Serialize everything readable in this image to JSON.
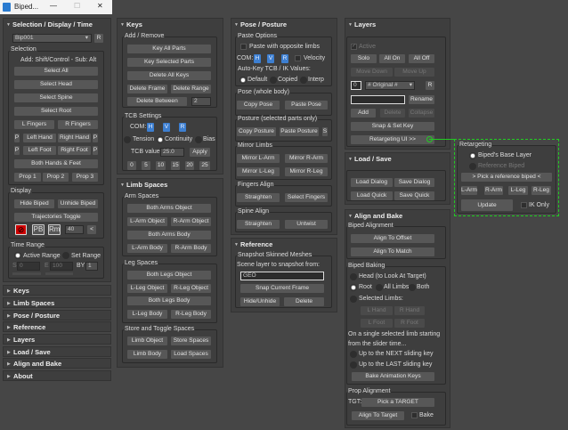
{
  "window": {
    "title": "Biped...",
    "min": "—",
    "max": "☐",
    "close": "✕"
  },
  "c1": {
    "header": "Selection / Display / Time",
    "bip": "Bip001",
    "r": "R",
    "sel": {
      "label": "Selection",
      "hint": "Add: Shift/Control - Sub: Alt",
      "all": "Select All",
      "head": "Select Head",
      "spine": "Select Spine",
      "root": "Select Root",
      "lf": "L Fingers",
      "rf": "R Fingers",
      "p": "P",
      "lh": "Left Hand",
      "rh": "Right Hand",
      "lfo": "Left Foot",
      "rfo": "Right Foot",
      "both": "Both Hands & Feet",
      "p1": "Prop 1",
      "p2": "Prop 2",
      "p3": "Prop 3"
    },
    "disp": {
      "label": "Display",
      "hide": "Hide Biped",
      "unhide": "Unhide Biped",
      "traj": "Trajectories Toggle",
      "pb": "PB",
      "rm": "Rm",
      "val": "40",
      "lt": "<"
    },
    "time": {
      "label": "Time Range",
      "active": "Active Range",
      "set": "Set Range",
      "s": "S",
      "sv": "0",
      "e": "E",
      "ev": "100",
      "by": "BY",
      "byv": "1"
    },
    "rollouts": [
      "Keys",
      "Limb Spaces",
      "Pose / Posture",
      "Reference",
      "Layers",
      "Load / Save",
      "Align and Bake",
      "About"
    ]
  },
  "keys": {
    "header": "Keys",
    "add": "Add / Remove",
    "kall": "Key All Parts",
    "ksel": "Key Selected Parts",
    "dall": "Delete All Keys",
    "dframe": "Delete Frame",
    "drange": "Delete Range",
    "dbetw": "Delete Between",
    "dbv": "2",
    "tcb": "TCB Settings",
    "com": "COM:",
    "h": "H",
    "v": "V",
    "r": "R",
    "tension": "Tension",
    "continuity": "Continuity",
    "bias": "Bias",
    "tcbl": "TCB value:",
    "tcbv": "25.0",
    "apply": "Apply",
    "nums": [
      "0",
      "5",
      "10",
      "15",
      "20",
      "25"
    ]
  },
  "limb": {
    "header": "Limb Spaces",
    "arm": "Arm Spaces",
    "bao": "Both Arms Object",
    "lao": "L-Arm Object",
    "rao": "R-Arm Object",
    "bab": "Both Arms Body",
    "lab": "L-Arm Body",
    "rab": "R-Arm Body",
    "leg": "Leg Spaces",
    "blo": "Both Legs Object",
    "llo": "L-Leg Object",
    "rlo": "R-Leg Object",
    "blb": "Both Legs Body",
    "llb": "L-Leg Body",
    "rlb": "R-Leg Body",
    "store": "Store and Toggle Spaces",
    "lo": "Limb Object",
    "ss": "Store Spaces",
    "lb": "Limb Body",
    "ls": "Load Spaces"
  },
  "pose": {
    "header": "Pose / Posture",
    "paste": "Paste Options",
    "opp": "Paste with opposite limbs",
    "com": "COM:",
    "h": "H",
    "v": "V",
    "r": "R",
    "vel": "Velocity",
    "auto": "Auto-Key TCB / IK Values:",
    "def": "Default",
    "cop": "Copied",
    "interp": "Interp",
    "pwb": "Pose (whole body)",
    "cp": "Copy Pose",
    "pp": "Paste Pose",
    "pos": "Posture (selected parts only)",
    "cpo": "Copy Posture",
    "ppo": "Paste Posture",
    "s": "S",
    "mirror": "Mirror Limbs",
    "mla": "Mirror L-Arm",
    "mra": "Mirror R-Arm",
    "mll": "Mirror L-Leg",
    "mrl": "Mirror R-Leg",
    "fa": "Fingers Align",
    "str": "Straighten",
    "self": "Select Fingers",
    "sa": "Spine Align",
    "untw": "Untwist"
  },
  "ref": {
    "header": "Reference",
    "snap": "Snapshot Skinned Meshes",
    "scene": "Scene layer to snapshot from:",
    "geo": "GEO",
    "scf": "Snap Current Frame",
    "hide": "Hide/Unhide",
    "del": "Delete"
  },
  "layers": {
    "header": "Layers",
    "active": "Active",
    "solo": "Solo",
    "allon": "All On",
    "alloff": "All Off",
    "md": "Move Down",
    "mu": "Move Up",
    "idx": "0",
    "orig": "# Original #",
    "r": "R",
    "rename": "Rename",
    "add": "Add",
    "del": "Delete",
    "coll": "Collapse",
    "snap": "Snap & Set Key",
    "retui": "Retargeting UI  >>"
  },
  "ls": {
    "header": "Load / Save",
    "ld": "Load Dialog",
    "sd": "Save Dialog",
    "lq": "Load Quick",
    "sq": "Save Quick"
  },
  "ab": {
    "header": "Align and Bake",
    "ba": "Biped Alignment",
    "ato": "Align To Offset",
    "atm": "Align To Match",
    "bb": "Biped Baking",
    "head": "Head (to Look At Target)",
    "root": "Root",
    "all": "All Limbs",
    "both": "Both",
    "sl": "Selected Limbs:",
    "lh": "L Hand",
    "rh": "R Hand",
    "lf": "L Foot",
    "rf": "R Foot",
    "t1": "On a single selected limb starting",
    "t2": "from the slider time...",
    "next": "Up to the NEXT sliding key",
    "last": "Up to the LAST sliding key",
    "bake": "Bake Animation Keys",
    "pa": "Prop Alignment",
    "tgt": "TGT:",
    "pick": "Pick a TARGET",
    "att": "Align To Target",
    "bk": "Bake"
  },
  "ret": {
    "title": "Retargeting",
    "base": "Biped's Base Layer",
    "refb": "Reference Biped",
    "pick": ">  Pick a reference biped  <",
    "la": "L-Arm",
    "ra": "R-Arm",
    "ll": "L-Leg",
    "rl": "R-Leg",
    "upd": "Update",
    "ik": "IK Only",
    "accent": "#22cc22"
  }
}
